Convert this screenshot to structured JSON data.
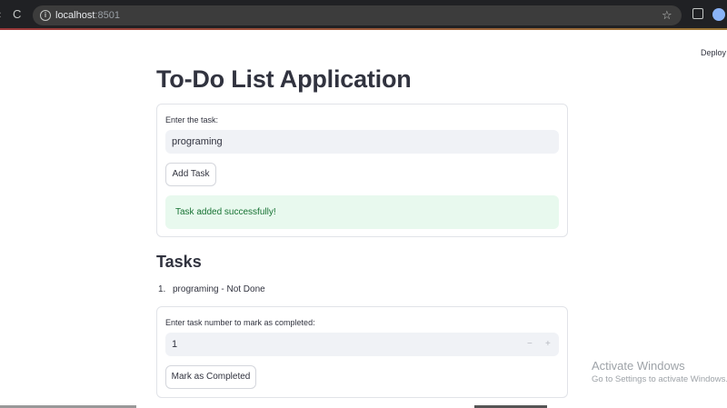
{
  "browser": {
    "url_host": "localhost",
    "url_port": ":8501",
    "back_glyph": "‹",
    "reload_glyph": "C",
    "info_glyph": "i",
    "star_glyph": "☆"
  },
  "header": {
    "deploy_label": "Deploy"
  },
  "main": {
    "title": "To-Do List Application",
    "add_form": {
      "label": "Enter the task:",
      "value": "programing",
      "button_label": "Add Task",
      "success_message": "Task added successfully!"
    },
    "tasks_heading": "Tasks",
    "tasks": [
      {
        "number": "1.",
        "text": "programing - Not Done"
      }
    ],
    "complete_form": {
      "label": "Enter task number to mark as completed:",
      "value": "1",
      "minus_glyph": "−",
      "plus_glyph": "+",
      "button_label": "Mark as Completed"
    }
  },
  "os_overlay": {
    "activate_title": "Activate Windows",
    "activate_sub": "Go to Settings to activate Windows."
  },
  "colors": {
    "accent": "#ff4b4b",
    "success_bg": "#e8f9ee",
    "success_text": "#177233",
    "input_bg": "#f0f2f6"
  }
}
